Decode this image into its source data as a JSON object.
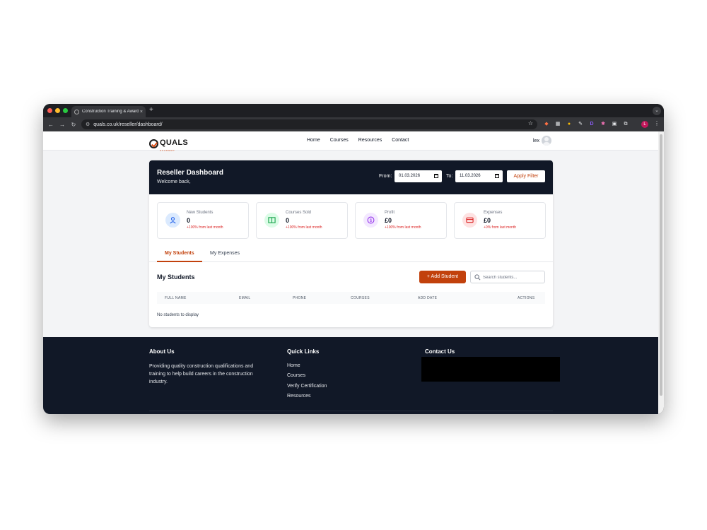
{
  "browser": {
    "tab_title": "Construction Training & Awards",
    "tab_close": "×",
    "new_tab": "+",
    "url": "quals.co.uk/reseller/dashboard/",
    "profile_initial": "L",
    "extensions": [
      "D"
    ]
  },
  "site": {
    "logo_text": "QUALS",
    "logo_sub": "ACADEMY",
    "nav": [
      "Home",
      "Courses",
      "Resources",
      "Contact"
    ],
    "user_name": "lex"
  },
  "dashboard": {
    "title": "Reseller Dashboard",
    "welcome": "Welcome back,",
    "from_label": "From:",
    "to_label": "To:",
    "from_date": "01.03.2026",
    "to_date": "11.03.2026",
    "apply_label": "Apply Filter",
    "stats": [
      {
        "label": "New Students",
        "value": "0",
        "change": "+100% from last month",
        "icon": "users-icon",
        "color": "#2563eb"
      },
      {
        "label": "Courses Sold",
        "value": "0",
        "change": "+100% from last month",
        "icon": "book-icon",
        "color": "#16a34a"
      },
      {
        "label": "Profit",
        "value": "£0",
        "change": "+100% from last month",
        "icon": "dollar-circle-icon",
        "color": "#9333ea"
      },
      {
        "label": "Expenses",
        "value": "£0",
        "change": "+0% from last month",
        "icon": "card-icon",
        "color": "#dc2626"
      }
    ],
    "tabs": [
      "My Students",
      "My Expenses"
    ],
    "section_title": "My Students",
    "add_label": "+ Add Student",
    "search_placeholder": "Search students...",
    "columns": [
      "FULL NAME",
      "EMAIL",
      "PHONE",
      "COURSES",
      "ADD DATE",
      "ACTIONS"
    ],
    "empty": "No students to display"
  },
  "footer": {
    "about_title": "About Us",
    "about_text": "Providing quality construction qualifications and training to help build careers in the construction industry.",
    "quick_title": "Quick Links",
    "quick_links": [
      "Home",
      "Courses",
      "Verify Certification",
      "Resources"
    ],
    "contact_title": "Contact Us"
  },
  "colors": {
    "accent": "#c2410c",
    "dark": "#111827"
  }
}
